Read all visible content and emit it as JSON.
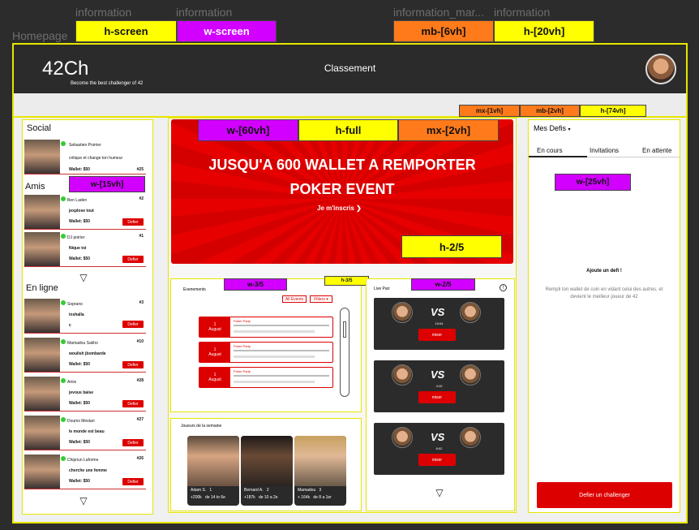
{
  "annotations": {
    "labels": [
      "information",
      "information",
      "information_mar...",
      "information"
    ],
    "homepage": "Homepage",
    "tags": {
      "h_screen": "h-screen",
      "w_screen": "w-screen",
      "mb_6vh": "mb-[6vh]",
      "h_20vh": "h-[20vh]",
      "mx_1vh": "mx-[1vh]",
      "mb_2vh": "mb-[2vh]",
      "h_74vh": "h-[74vh]",
      "w_15vh": "w-[15vh]",
      "w_60vh": "w-[60vh]",
      "h_full": "h-full",
      "mx_2vh": "mx-[2vh]",
      "h_2_5": "h-2/5",
      "w_3_5": "w-3/5",
      "h_3_5": "h-3/5",
      "w_2_5": "w-2/5",
      "w_25vh": "w-[25vh]"
    }
  },
  "header": {
    "logo": "42Ch",
    "tagline": "Become the best challenger of 42",
    "title": "Classement"
  },
  "social": {
    "title": "Social",
    "top_card": {
      "name": "Sebastien Poirrier",
      "status": "critique et change ton humeur",
      "wallet": "Wallet: $50",
      "rank": "#25"
    },
    "friends_title": "Amis",
    "friends": [
      {
        "name": "Ben Laden",
        "status": "jexplose tout",
        "wallet": "Wallet: $50",
        "rank": "#2",
        "button": "Defier"
      },
      {
        "name": "DJ poirier",
        "status": "Nique toi",
        "wallet": "Wallet: $50",
        "rank": "#1",
        "button": "Defier"
      }
    ],
    "online_title": "En ligne",
    "online": [
      {
        "name": "Soprano",
        "status": "inshalla",
        "wallet": "c",
        "rank": "#3",
        "button": "Defier"
      },
      {
        "name": "Mamadou Sakho",
        "status": "woulish jbombarde",
        "wallet": "Wallet: $50",
        "rank": "#10",
        "button": "Defier"
      },
      {
        "name": "Amix",
        "status": "jevous baise",
        "wallet": "Wallet: $50",
        "rank": "#28",
        "button": "Defier"
      },
      {
        "name": "Doums Mestari",
        "status": "le monde est beau",
        "wallet": "Wallet: $50",
        "rank": "#27",
        "button": "Defier"
      },
      {
        "name": "Chipriun Laforme",
        "status": "cherche une femme",
        "wallet": "Wallet: $50",
        "rank": "#26",
        "button": "Defier"
      }
    ]
  },
  "banner": {
    "line1": "JUSQU'A 600 WALLET A REMPORTER",
    "line2": "POKER EVENT",
    "cta": "Je m'inscris"
  },
  "events": {
    "title": "Evenements",
    "all_button": "All Events",
    "filter_button": "Filters",
    "items": [
      {
        "day": "1",
        "month": "August",
        "title": "Poker Party"
      },
      {
        "day": "1",
        "month": "August",
        "title": "Poker Party"
      },
      {
        "day": "1",
        "month": "August",
        "title": "Poker Party"
      }
    ]
  },
  "live": {
    "title": "Live Pari",
    "duels": [
      {
        "time": "10:04",
        "button": "miser"
      },
      {
        "time": "4:10",
        "button": "miser"
      },
      {
        "time": "6:02",
        "button": "miser"
      }
    ]
  },
  "players": {
    "title": "Joueurs de la semaine",
    "items": [
      {
        "name": "Adam S.",
        "rank": "1",
        "gain": "+200k",
        "range": "de 14 to 6e"
      },
      {
        "name": "Bernard A.",
        "rank": "2",
        "gain": "+187k",
        "range": "de 10 a 2e"
      },
      {
        "name": "Mamadou",
        "rank": "3",
        "gain": "+ 164k",
        "range": "de 8 a 1er"
      }
    ]
  },
  "defis": {
    "title": "Mes Defis",
    "tabs": [
      "En cours",
      "Invitations",
      "En attente"
    ],
    "empty_title": "Ajoute un defi !",
    "empty_text": "Rempli ton wallet de coin en vidant celui des autres, et devient le meilleur joueur de 42",
    "button": "Defier un challenger"
  }
}
